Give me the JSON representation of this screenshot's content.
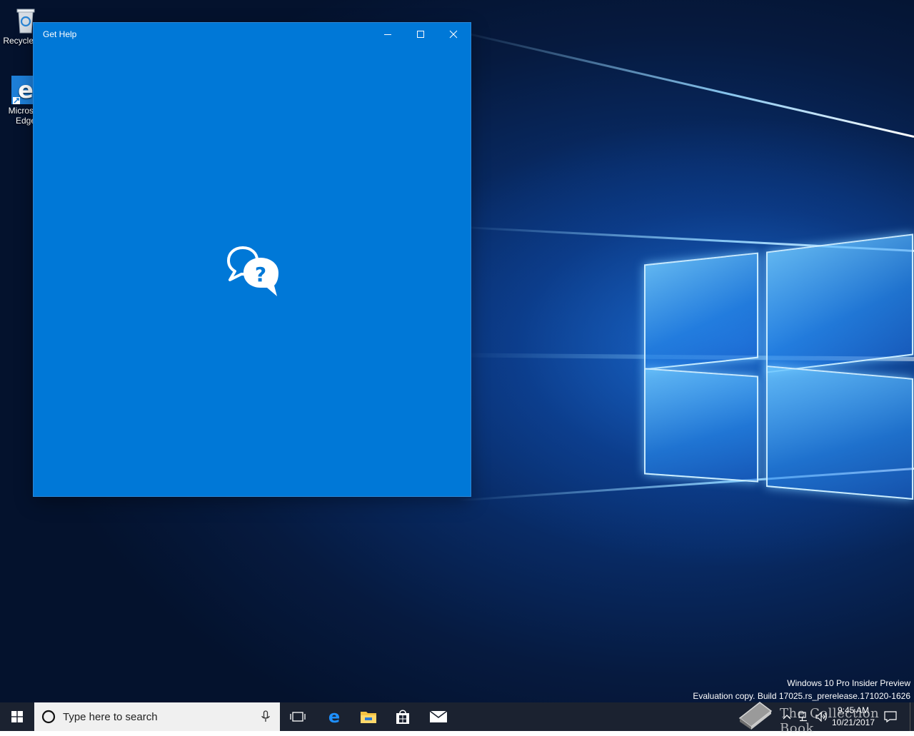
{
  "desktop": {
    "icons": [
      {
        "label": "Recycle Bin",
        "icon": "recycle-bin-icon"
      },
      {
        "label": "Microsoft Edge",
        "icon": "edge-icon"
      }
    ],
    "watermark": {
      "line1": "Windows 10 Pro Insider Preview",
      "line2": "Evaluation copy. Build 17025.rs_prerelease.171020-1626"
    }
  },
  "window": {
    "title": "Get Help",
    "background_color": "#0078d7",
    "controls": {
      "minimize": "minimize-icon",
      "maximize": "maximize-icon",
      "close": "close-icon"
    },
    "splash_icon": "help-chat-bubbles-icon"
  },
  "taskbar": {
    "search_placeholder": "Type here to search",
    "pinned": [
      "task-view-icon",
      "edge-icon",
      "file-explorer-icon",
      "store-icon",
      "mail-icon"
    ],
    "tray": {
      "time": "9:45 AM",
      "date": "10/21/2017"
    },
    "overlay_text": "The Collection Book"
  }
}
